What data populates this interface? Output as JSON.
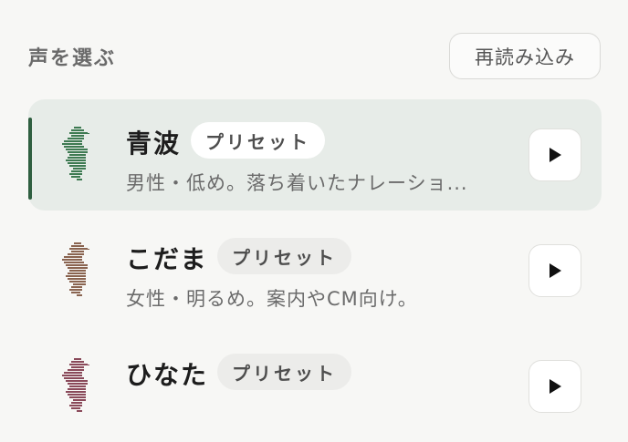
{
  "header": {
    "title": "声を選ぶ",
    "reload_label": "再読み込み"
  },
  "voices": [
    {
      "name": "青波",
      "badge": "プリセット",
      "description": "男性・低め。落ち着いたナレーショ...",
      "selected": true,
      "icon": "seahorse-icon",
      "icon_color": "#3e7a52"
    },
    {
      "name": "こだま",
      "badge": "プリセット",
      "description": "女性・明るめ。案内やCM向け。",
      "selected": false,
      "icon": "seahorse-icon",
      "icon_color": "#8a6450"
    },
    {
      "name": "ひなた",
      "badge": "プリセット",
      "description": "",
      "selected": false,
      "icon": "seahorse-icon",
      "icon_color": "#8a4a5a"
    }
  ],
  "colors": {
    "accent": "#2f5f40",
    "selected_bg": "#e7ece8",
    "page_bg": "#f7f7f5"
  }
}
